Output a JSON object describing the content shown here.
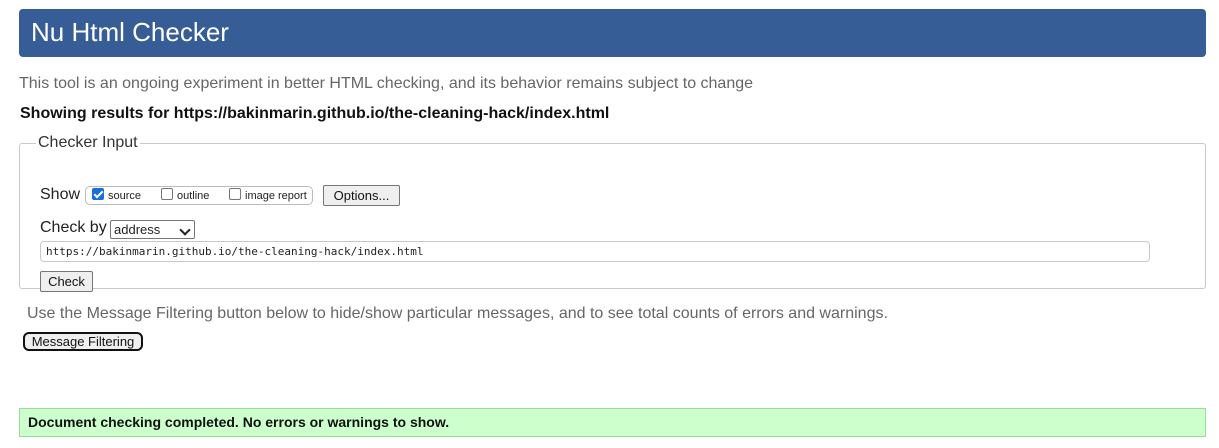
{
  "header": {
    "title": "Nu Html Checker"
  },
  "intro": "This tool is an ongoing experiment in better HTML checking, and its behavior remains subject to change",
  "showing": "Showing results for https://bakinmarin.github.io/the-cleaning-hack/index.html",
  "checker_input": {
    "legend": "Checker Input",
    "show_label": "Show",
    "options": [
      {
        "label": "source",
        "checked": true
      },
      {
        "label": "outline",
        "checked": false
      },
      {
        "label": "image report",
        "checked": false
      }
    ],
    "options_button": "Options...",
    "check_by_label": "Check by",
    "check_by_value": "address",
    "url_value": "https://bakinmarin.github.io/the-cleaning-hack/index.html",
    "check_button": "Check"
  },
  "filter": {
    "text": "Use the Message Filtering button below to hide/show particular messages, and to see total counts of errors and warnings.",
    "button": "Message Filtering"
  },
  "result": "Document checking completed. No errors or warnings to show.",
  "colors": {
    "header": "#365d95",
    "success_bg": "#ccffcc"
  }
}
